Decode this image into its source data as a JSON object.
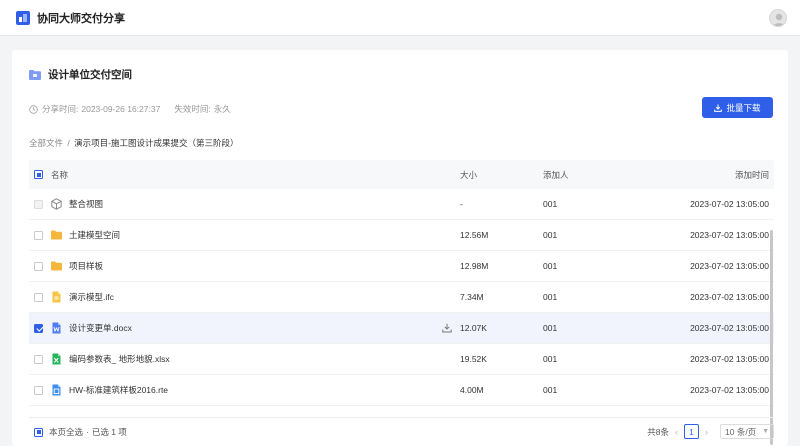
{
  "app": {
    "title": "协同大师交付分享"
  },
  "card": {
    "title": "设计单位交付空间",
    "share_time_label": "分享时间:",
    "share_time": "2023-09-26 16:27:37",
    "expire_label": "失效时间:",
    "expire_value": "永久",
    "batch_download": "批量下载"
  },
  "breadcrumb": {
    "root": "全部文件",
    "separator": "/",
    "current": "演示项目-施工图设计成果提交（第三阶段）"
  },
  "table": {
    "columns": {
      "name": "名称",
      "size": "大小",
      "adder": "添加人",
      "time": "添加时间"
    },
    "rows": [
      {
        "icon": "model-view-icon",
        "name": "整合视图",
        "size": "-",
        "adder": "001",
        "time": "2023-07-02 13:05:00",
        "checked": false,
        "disabled": true
      },
      {
        "icon": "folder-icon",
        "name": "土建模型空间",
        "size": "12.56M",
        "adder": "001",
        "time": "2023-07-02 13:05:00",
        "checked": false,
        "disabled": false
      },
      {
        "icon": "folder-icon",
        "name": "项目样板",
        "size": "12.98M",
        "adder": "001",
        "time": "2023-07-02 13:05:00",
        "checked": false,
        "disabled": false
      },
      {
        "icon": "ifc-file-icon",
        "name": "演示模型.ifc",
        "size": "7.34M",
        "adder": "001",
        "time": "2023-07-02 13:05:00",
        "checked": false,
        "disabled": false
      },
      {
        "icon": "word-file-icon",
        "name": "设计变更单.docx",
        "size": "12.07K",
        "adder": "001",
        "time": "2023-07-02 13:05:00",
        "checked": true,
        "disabled": false
      },
      {
        "icon": "excel-file-icon",
        "name": "编码参数表_ 地形地貌.xlsx",
        "size": "19.52K",
        "adder": "001",
        "time": "2023-07-02 13:05:00",
        "checked": false,
        "disabled": false
      },
      {
        "icon": "rte-file-icon",
        "name": "HW-标准建筑样板2016.rte",
        "size": "4.00M",
        "adder": "001",
        "time": "2023-07-02 13:05:00",
        "checked": false,
        "disabled": false
      }
    ]
  },
  "footer": {
    "select_all": "本页全选",
    "selected_text": "已选 1 项",
    "total": "共8条",
    "current_page": "1",
    "page_size": "10 条/页"
  },
  "colors": {
    "accent": "#2f5fe8",
    "folder": "#f5b73b"
  }
}
